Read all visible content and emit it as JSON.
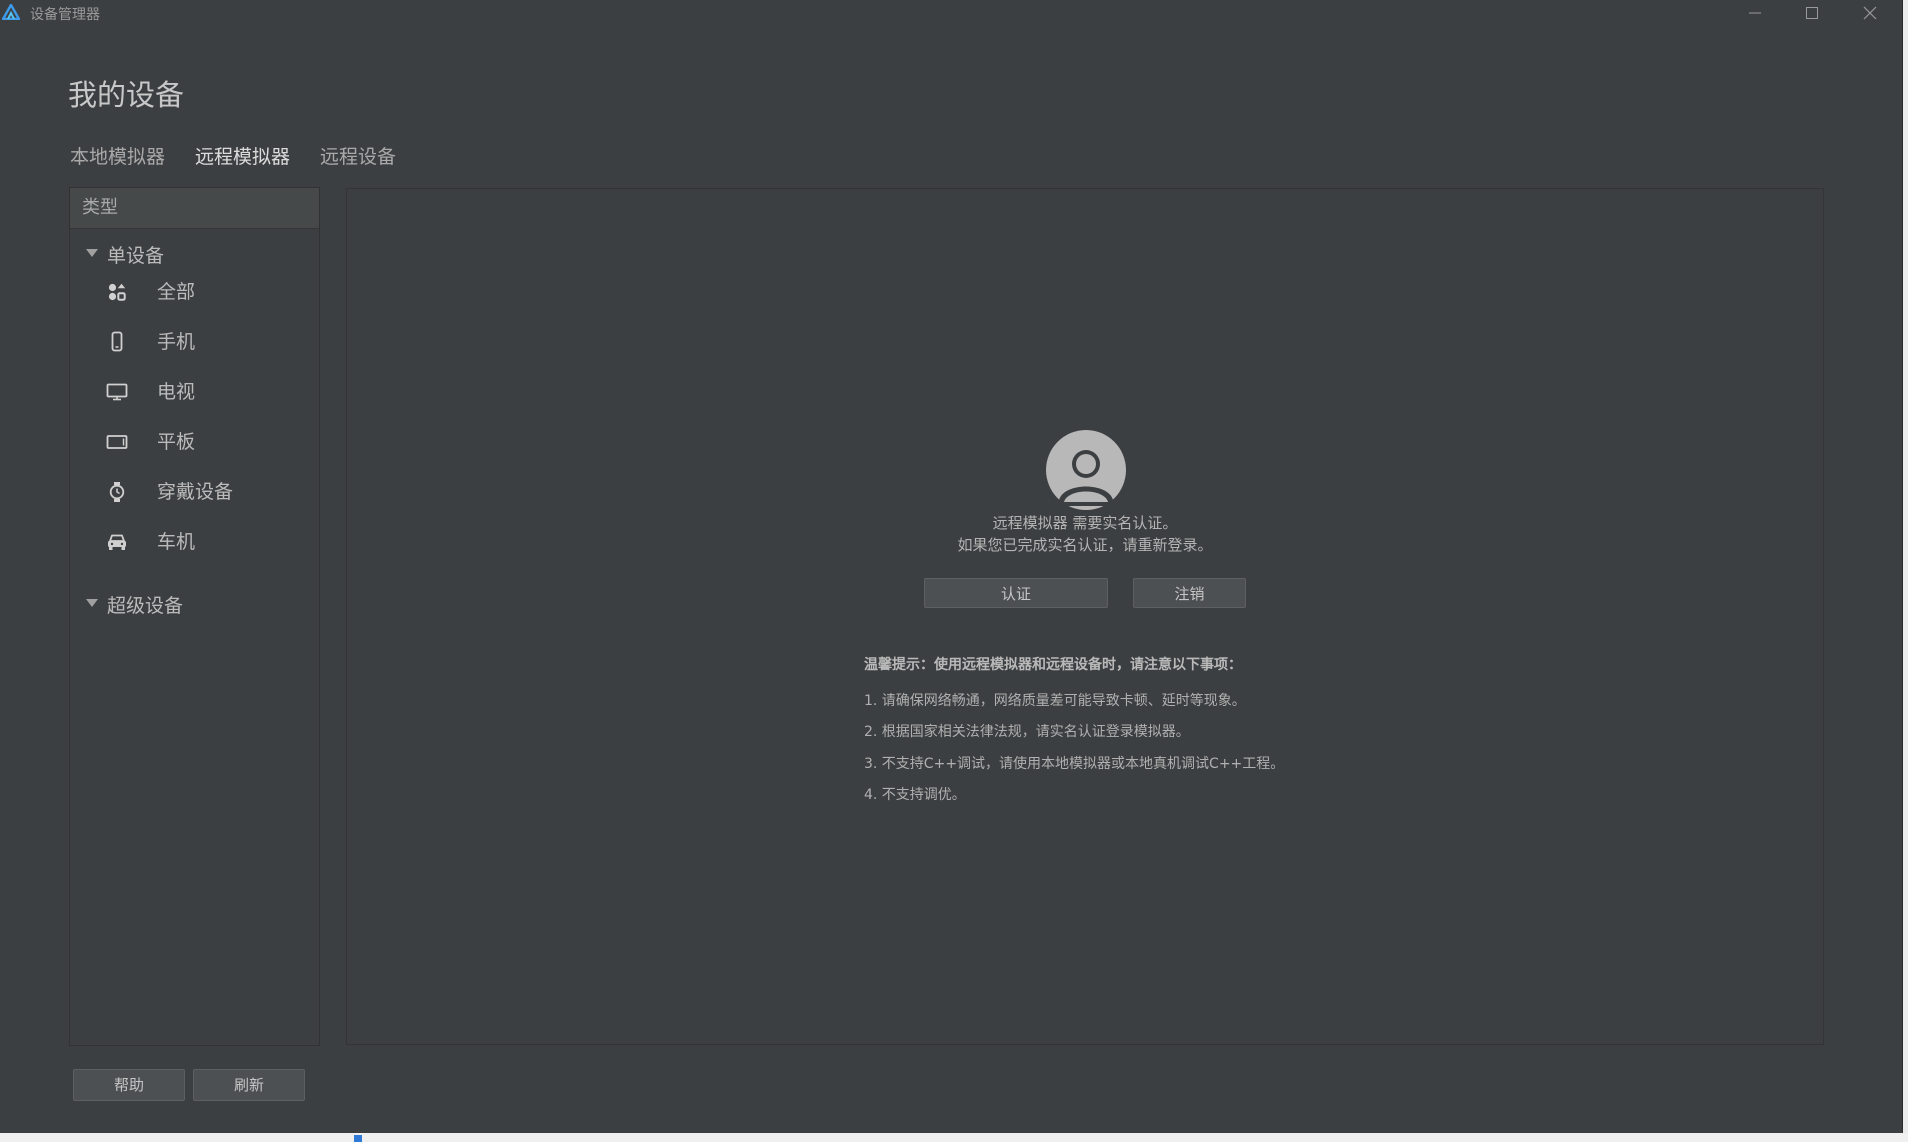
{
  "window": {
    "title": "设备管理器"
  },
  "page": {
    "title": "我的设备"
  },
  "tabs": [
    {
      "label": "本地模拟器",
      "active": false
    },
    {
      "label": "远程模拟器",
      "active": true
    },
    {
      "label": "远程设备",
      "active": false
    }
  ],
  "sidebar": {
    "header": "类型",
    "groups": [
      {
        "label": "单设备",
        "expanded": true,
        "items": [
          {
            "label": "全部",
            "icon": "grid-apps-icon"
          },
          {
            "label": "手机",
            "icon": "phone-icon"
          },
          {
            "label": "电视",
            "icon": "tv-icon"
          },
          {
            "label": "平板",
            "icon": "tablet-icon"
          },
          {
            "label": "穿戴设备",
            "icon": "watch-icon"
          },
          {
            "label": "车机",
            "icon": "car-icon"
          }
        ]
      },
      {
        "label": "超级设备",
        "expanded": true,
        "items": []
      }
    ]
  },
  "main": {
    "notice_line1": "远程模拟器 需要实名认证。",
    "notice_line2": "如果您已完成实名认证，请重新登录。",
    "auth_button": "认证",
    "logout_button": "注销",
    "tips_title": "温馨提示：使用远程模拟器和远程设备时，请注意以下事项：",
    "tips": [
      "1. 请确保网络畅通，网络质量差可能导致卡顿、延时等现象。",
      "2. 根据国家相关法律法规，请实名认证登录模拟器。",
      "3. 不支持C++调试，请使用本地模拟器或本地真机调试C++工程。",
      "4. 不支持调优。"
    ]
  },
  "footer": {
    "help_button": "帮助",
    "refresh_button": "刷新"
  },
  "colors": {
    "window_bg": "#3c3f41",
    "panel_border": "#343434",
    "button_bg": "#4c5052",
    "text": "#bbbbbb"
  }
}
